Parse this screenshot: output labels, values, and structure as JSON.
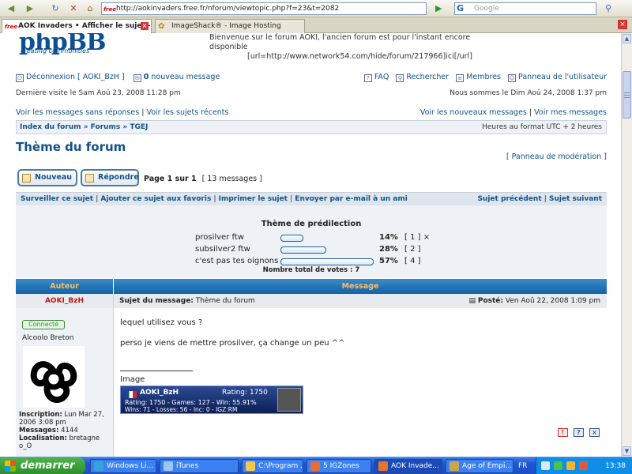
{
  "browser": {
    "url": "http://aokinvaders.free.fr/nforum/viewtopic.php?f=23&t=2082",
    "url_favicon": "free",
    "search_placeholder": "Google",
    "search_engine_letter": "G",
    "tabs": [
      {
        "label": "AOK Invaders • Afficher le sujet -...",
        "favicon": "free",
        "active": true
      },
      {
        "label": "ImageShack® - Image Hosting",
        "favicon": "imageshack",
        "active": false
      }
    ]
  },
  "header": {
    "logo_text": "phpBB",
    "logo_tagline": "creating communities",
    "description_line1": "Bienvenue sur le forum AOKI, l'ancien forum est pour l'instant encore disponible",
    "description_line2": "[url=http://www.network54.com/hide/forum/217966]ici[/url]"
  },
  "nav": {
    "logout": "Déconnexion [ AOKI_BzH ]",
    "new_messages_count": "0",
    "new_messages_label": "nouveau message",
    "faq": "FAQ",
    "search": "Rechercher",
    "members": "Membres",
    "user_panel": "Panneau de l'utilisateur",
    "last_visit": "Dernière visite le Sam Aoû 23, 2008 11:28 pm",
    "current_date": "Nous sommes le Dim Aoû 24, 2008 1:37 pm",
    "unanswered": "Voir les messages sans réponses",
    "recent_topics": "Voir les sujets récents",
    "new_posts": "Voir les nouveaux messages",
    "my_posts": "Voir mes messages",
    "sep": "|"
  },
  "breadcrumb": {
    "items": [
      "Index du forum",
      "Forums",
      "TGEJ"
    ],
    "sep": "»",
    "timezone": "Heures au format UTC + 2 heures"
  },
  "topic": {
    "title": "Thème du forum",
    "moderation_panel": "Panneau de modération",
    "new_button": "Nouveau",
    "reply_button": "Répondre",
    "page_info": "Page 1 sur 1",
    "message_count": "[ 13 messages ]",
    "actions": [
      "Surveiller ce sujet",
      "Ajouter ce sujet aux favoris",
      "Imprimer le sujet",
      "Envoyer par e-mail à un ami"
    ],
    "prev_topic": "Sujet précédent",
    "next_topic": "Sujet suivant"
  },
  "poll": {
    "title": "Thème de prédilection",
    "options": [
      {
        "label": "prosilver ftw",
        "percent": 14,
        "percent_text": "14%",
        "votes_text": "[ 1 ]",
        "voted_mark": "×"
      },
      {
        "label": "subsilver2 ftw",
        "percent": 28,
        "percent_text": "28%",
        "votes_text": "[ 2 ]",
        "voted_mark": ""
      },
      {
        "label": "c'est pas tes oignons",
        "percent": 57,
        "percent_text": "57%",
        "votes_text": "[ 4 ]",
        "voted_mark": ""
      }
    ],
    "total": "Nombre total de votes : 7"
  },
  "table": {
    "author_header": "Auteur",
    "message_header": "Message"
  },
  "post": {
    "author": "AOKI_BzH",
    "subject_label": "Sujet du message:",
    "subject": "Thème du forum",
    "posted_label": "Posté:",
    "posted_date": "Ven Aoû 22, 2008 1:09 pm",
    "online_badge": "Connecté",
    "rank": "Alcoolo Breton",
    "registration_label": "Inscription:",
    "registration_value": "Lun Mar 27, 2006 3:08 pm",
    "messages_label": "Messages:",
    "messages_value": "4144",
    "location_label": "Localisation:",
    "location_value": "bretagne",
    "extra_line": "o_O",
    "body_line1": "lequel utilisez vous ?",
    "body_line2": "perso je viens de mettre prosilver, ça change un peu ^^",
    "image_label": "Image",
    "signature": {
      "name": "AOKI_BzH",
      "rating_label": "Rating:",
      "rating": "1750",
      "line2": "Rating: 1750 - Games: 127 - Win: 55.91%",
      "line3": "Wins: 71 - Losses: 56 - Inc: 0 - IGZ:RM"
    },
    "icons": [
      "!",
      "?",
      "×"
    ]
  },
  "taskbar": {
    "start": "demarrer",
    "items": [
      {
        "label": "Windows Li...",
        "color": "#3aa0e0",
        "active": false
      },
      {
        "label": "iTunes",
        "color": "#9bc7f0",
        "active": false
      },
      {
        "label": "C:\\Program ...",
        "color": "#f2c94c",
        "active": false
      },
      {
        "label": "5 IGZones",
        "color": "#e86b3a",
        "active": false
      },
      {
        "label": "AOK Invade...",
        "color": "#e6742a",
        "active": true
      },
      {
        "label": "Age of Empi...",
        "color": "#c8a84a",
        "active": false
      }
    ],
    "language": "FR",
    "clock": "13:38"
  }
}
